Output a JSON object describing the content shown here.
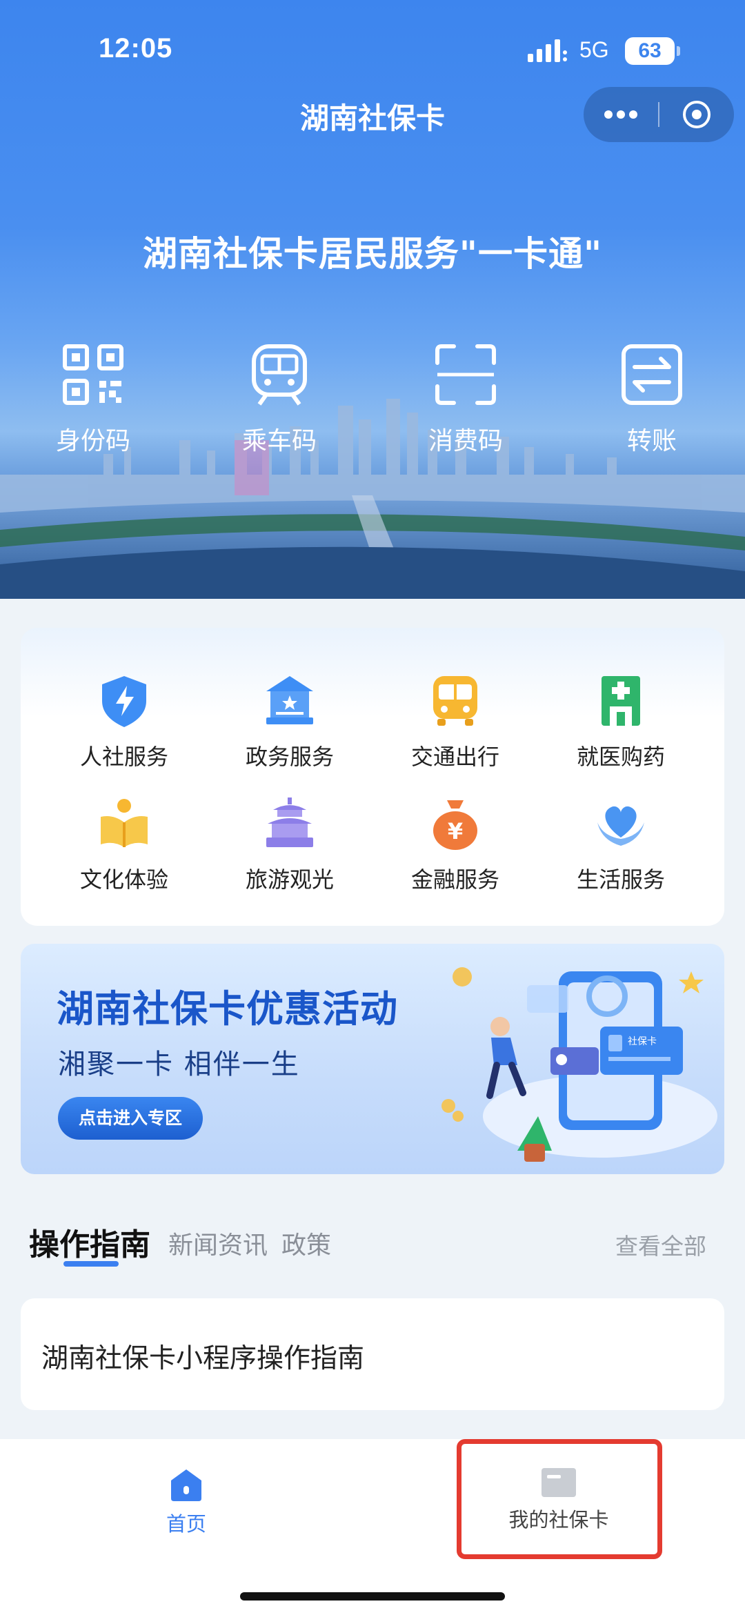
{
  "status_bar": {
    "time": "12:05",
    "network": "5G",
    "battery": "63"
  },
  "nav": {
    "title": "湖南社保卡",
    "more_icon": "more-dots-icon",
    "close_icon": "close-circle-icon"
  },
  "hero": {
    "title": "湖南社保卡居民服务\"一卡通\""
  },
  "quick_actions": [
    {
      "label": "身份码",
      "icon": "qr-code-icon"
    },
    {
      "label": "乘车码",
      "icon": "train-icon"
    },
    {
      "label": "消费码",
      "icon": "scan-icon"
    },
    {
      "label": "转账",
      "icon": "transfer-icon"
    }
  ],
  "services": [
    {
      "label": "人社服务",
      "icon": "shield-bolt-icon",
      "color": "#3e8ef5"
    },
    {
      "label": "政务服务",
      "icon": "government-building-icon",
      "color": "#3e8ef5"
    },
    {
      "label": "交通出行",
      "icon": "bus-icon",
      "color": "#f7b731"
    },
    {
      "label": "就医购药",
      "icon": "hospital-icon",
      "color": "#2fb56b"
    },
    {
      "label": "文化体验",
      "icon": "reading-book-icon",
      "color": "#f7b731"
    },
    {
      "label": "旅游观光",
      "icon": "temple-icon",
      "color": "#8c7ee8"
    },
    {
      "label": "金融服务",
      "icon": "money-bag-icon",
      "color": "#f07a3a"
    },
    {
      "label": "生活服务",
      "icon": "heart-hands-icon",
      "color": "#4a95f2"
    }
  ],
  "banner": {
    "title": "湖南社保卡优惠活动",
    "subtitle": "湘聚一卡  相伴一生",
    "button": "点击进入专区",
    "card_label": "社保卡"
  },
  "info_tabs": {
    "active": "操作指南",
    "tabs": [
      "新闻资讯",
      "政策"
    ],
    "view_all": "查看全部"
  },
  "guide": {
    "title": "湖南社保卡小程序操作指南"
  },
  "tabbar": {
    "items": [
      {
        "label": "首页",
        "icon": "home-icon",
        "active": true
      },
      {
        "label": "我的社保卡",
        "icon": "card-icon",
        "active": false
      }
    ],
    "highlight_color": "#e43b30"
  }
}
